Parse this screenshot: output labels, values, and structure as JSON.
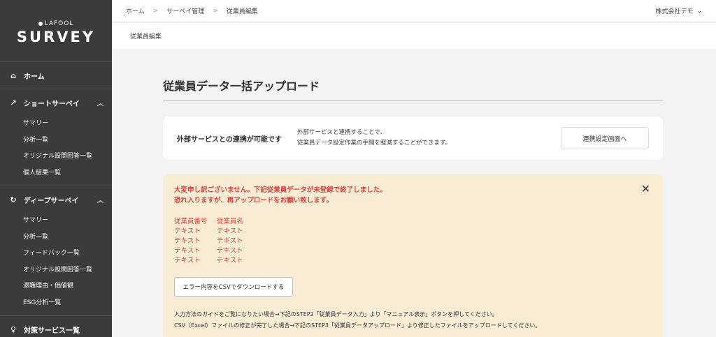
{
  "sidebar": {
    "logo_sub": "LAFOOL",
    "logo_main": "SURVEY",
    "home": {
      "label": "ホーム",
      "icon": "home-icon"
    },
    "short": {
      "label": "ショートサーベイ",
      "icon": "trend-icon",
      "items": [
        "サマリー",
        "分析一覧",
        "オリジナル設問回答一覧",
        "個人結果一覧"
      ]
    },
    "deep": {
      "label": "ディープサーベイ",
      "icon": "refresh-icon",
      "items": [
        "サマリー",
        "分析一覧",
        "フィードバック一覧",
        "オリジナル設問回答一覧",
        "退職理由・価値観",
        "ESG分析一覧"
      ]
    },
    "measures": {
      "label": "対策サービス一覧",
      "icon": "lightbulb-icon"
    }
  },
  "topbar": {
    "breadcrumb": [
      "ホーム",
      "サーベイ管理",
      "従業員編集"
    ],
    "company": "株式会社デモ"
  },
  "subhead": "従業員編集",
  "main": {
    "title": "従業員データ一括アップロード",
    "link_card": {
      "title": "外部サービスとの連携が可能です",
      "desc1": "外部サービスと連携することで、",
      "desc2": "従業員データ設定作業の手間を軽減することができます。",
      "button": "連携設定画面へ"
    },
    "error": {
      "line1": "大変申し訳ございません。下記従業員データが未登録で終了しました。",
      "line2": "恐れ入りますが、再アップロードをお願い致します。",
      "headers": [
        "従業員番号",
        "従業員名"
      ],
      "rows": [
        [
          "テキスト",
          "テキスト"
        ],
        [
          "テキスト",
          "テキスト"
        ],
        [
          "テキスト",
          "テキスト"
        ],
        [
          "テキスト",
          "テキスト"
        ]
      ],
      "csv_button": "エラー内容をCSVでダウンロードする",
      "guide1": "入力方法のガイドをご覧になりたい場合→下記のSTEP2「従業員データ入力」より「マニュアル表示」ボタンを押してください。",
      "guide2": "CSV（Excel）ファイルの修正が完了した場合→下記のSTEP3「従業員データアップロード」より修正したファイルをアップロードしてください。"
    }
  },
  "colors": {
    "sidebar": "#3b3b3b",
    "error_text": "#d9443d",
    "error_bg": "#f8ecd5"
  }
}
